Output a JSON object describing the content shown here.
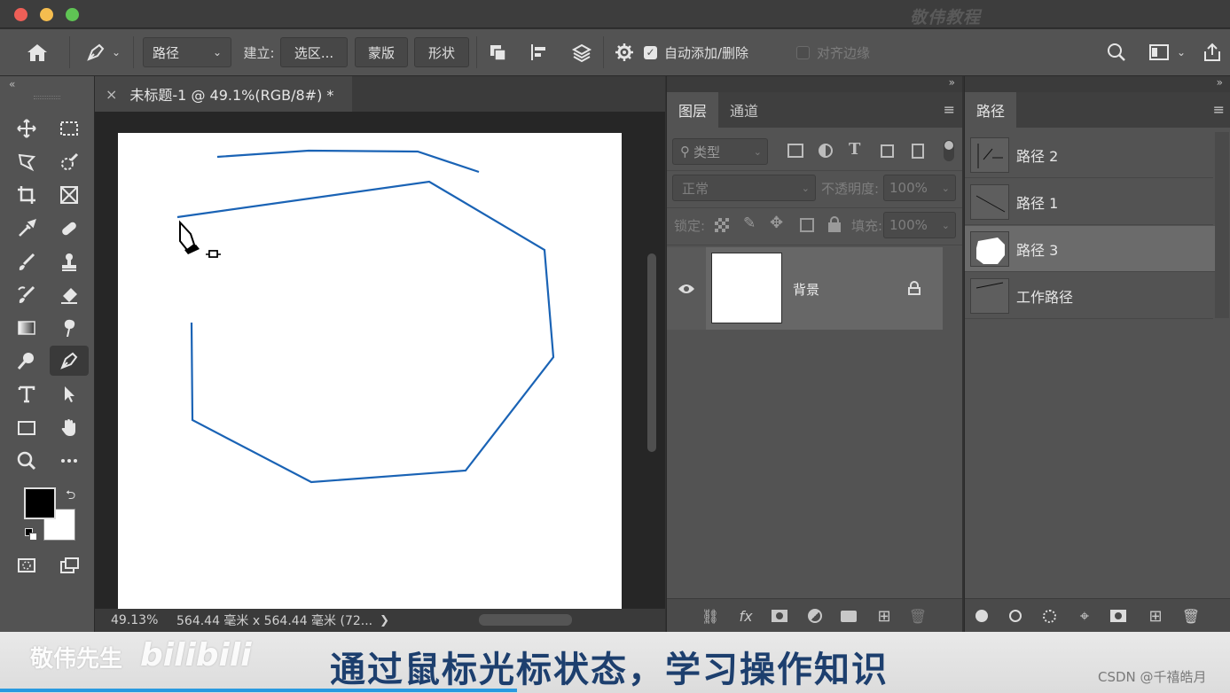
{
  "watermark_top": "敬伟教程",
  "options": {
    "mode_value": "路径",
    "make_label": "建立:",
    "selection_btn": "选区...",
    "mask_btn": "蒙版",
    "shape_btn": "形状",
    "auto_add_delete": "自动添加/删除",
    "auto_add_delete_checked": true,
    "align_edges": "对齐边缘",
    "align_edges_checked": false
  },
  "document": {
    "tab_title": "未标题-1 @ 49.1%(RGB/8#) *",
    "zoom": "49.13%",
    "dimensions": "564.44 毫米 x 564.44 毫米 (72...",
    "path_color": "#1a63b5"
  },
  "layers_panel": {
    "tabs": [
      "图层",
      "通道"
    ],
    "filter_placeholder": "类型",
    "blend_mode": "正常",
    "opacity_label": "不透明度:",
    "opacity_value": "100%",
    "lock_label": "锁定:",
    "fill_label": "填充:",
    "fill_value": "100%",
    "layers": [
      {
        "name": "背景",
        "visible": true,
        "locked": true
      }
    ]
  },
  "paths_panel": {
    "tab": "路径",
    "items": [
      {
        "name": "路径 2",
        "selected": false
      },
      {
        "name": "路径 1",
        "selected": false
      },
      {
        "name": "路径 3",
        "selected": true
      },
      {
        "name": "工作路径",
        "selected": false
      }
    ]
  },
  "subtitle": {
    "text": "通过鼠标光标状态，学习操作知识",
    "channel_name": "敬伟先生",
    "bili_logo": "bilibili",
    "credit": "CSDN @千禧皓月",
    "progress": 0.42
  }
}
